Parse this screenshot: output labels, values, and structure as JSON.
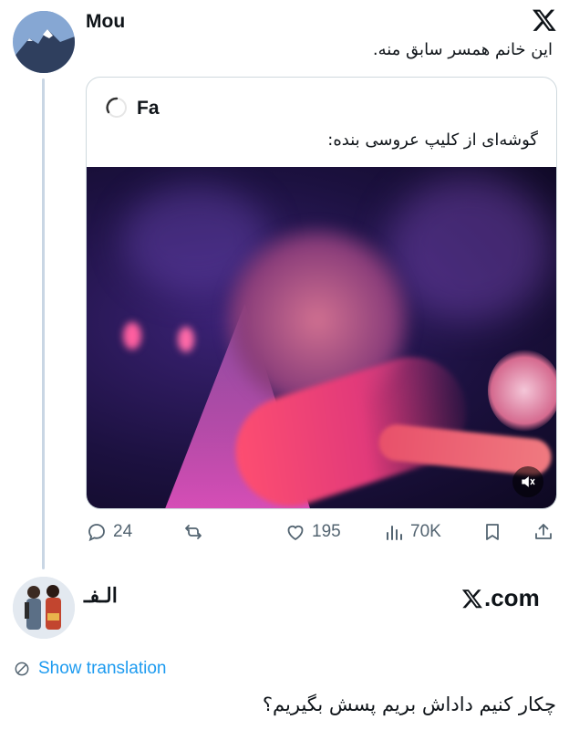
{
  "main_tweet": {
    "author": "Mou",
    "text": "این خانم همسر سابق منه.",
    "quoted": {
      "author": "Fa",
      "text": "گوشه‌ای از کلیپ عروسی بنده:"
    },
    "stats": {
      "replies": "24",
      "likes": "195",
      "views": "70K"
    }
  },
  "reply": {
    "author": "الـفـ",
    "source": ".com",
    "show_translation": "Show translation",
    "text": "چکار کنیم داداش بریم پسش بگیریم؟"
  },
  "icons": {
    "logo": "x-logo-icon",
    "reply": "reply-icon",
    "retweet": "retweet-icon",
    "like": "heart-icon",
    "views": "views-icon",
    "bookmark": "bookmark-icon",
    "share": "share-icon",
    "mute": "speaker-muted-icon",
    "translate": "globe-icon"
  },
  "colors": {
    "text": "#0f1419",
    "muted": "#536471",
    "link": "#1d9bf0",
    "border": "#cfd9de"
  }
}
